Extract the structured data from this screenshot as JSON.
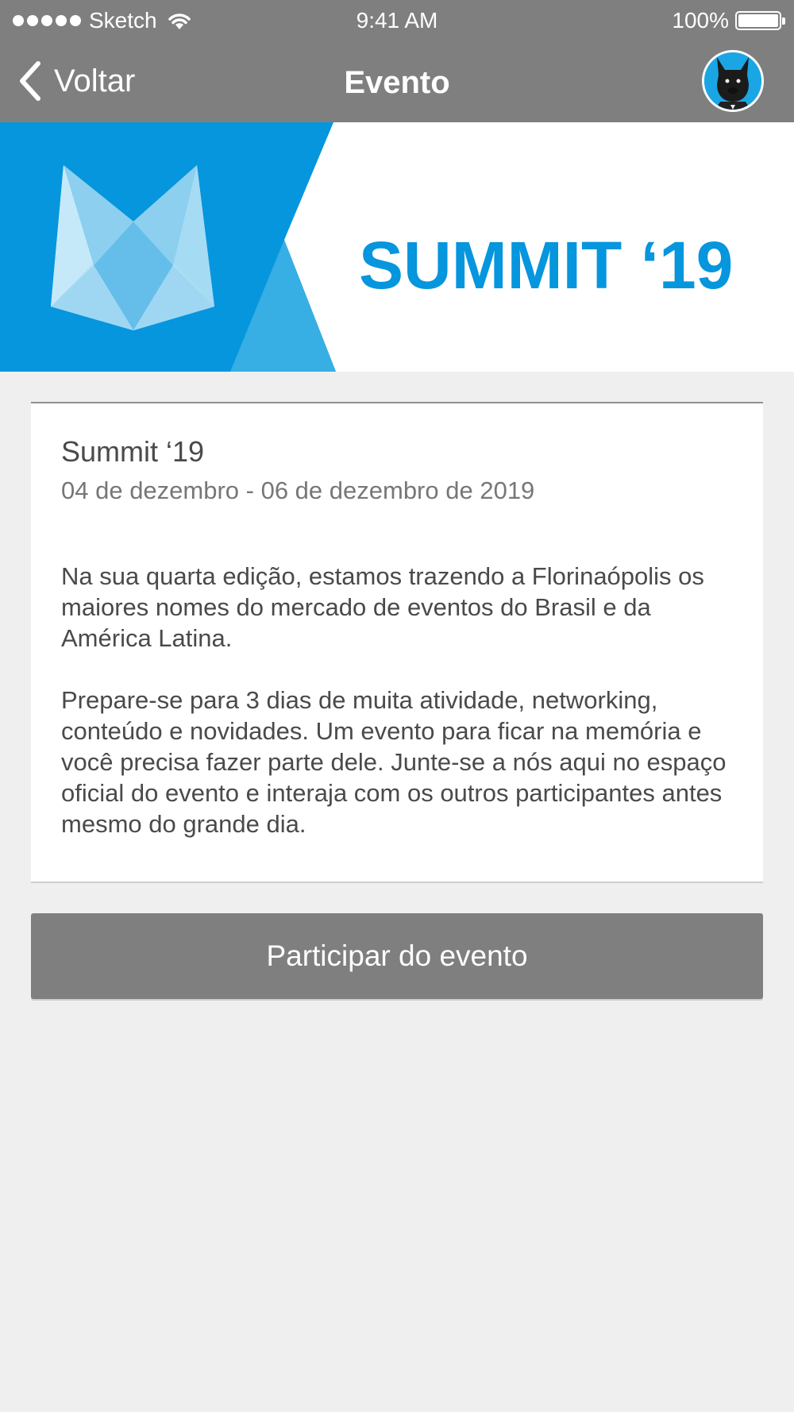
{
  "status_bar": {
    "carrier": "Sketch",
    "time": "9:41 AM",
    "battery": "100%"
  },
  "nav": {
    "back_label": "Voltar",
    "title": "Evento",
    "avatar_icon": "french-bulldog-avatar"
  },
  "banner": {
    "title": "SUMMIT ‘19",
    "brand_color": "#0596de",
    "logo_icon": "m-crystal-logo"
  },
  "event": {
    "name": "Summit ‘19",
    "dates": "04 de dezembro - 06 de dezembro de 2019",
    "description": [
      "Na sua quarta edição, estamos trazendo a Florinaópolis os maiores nomes do mercado de eventos do Brasil e da América Latina.",
      "Prepare-se para 3 dias de muita atividade, networking, conteúdo e novidades. Um evento para ficar na memória e você precisa fazer parte dele. Junte-se a nós aqui no espaço oficial do evento e interaja com os outros participantes antes mesmo do grande dia."
    ]
  },
  "cta": {
    "label": "Participar do evento"
  }
}
